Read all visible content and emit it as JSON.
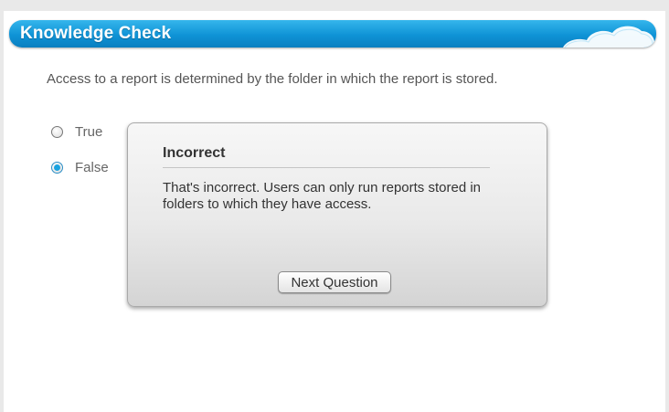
{
  "header": {
    "title": "Knowledge Check",
    "accent_color": "#1aa3e0"
  },
  "question": {
    "text": "Access to a report is determined by the folder in which the report is stored."
  },
  "options": [
    {
      "label": "True",
      "selected": false
    },
    {
      "label": "False",
      "selected": true
    }
  ],
  "feedback": {
    "title": "Incorrect",
    "body": "That's incorrect. Users can only run reports stored in folders to which they have access.",
    "button_label": "Next Question"
  }
}
